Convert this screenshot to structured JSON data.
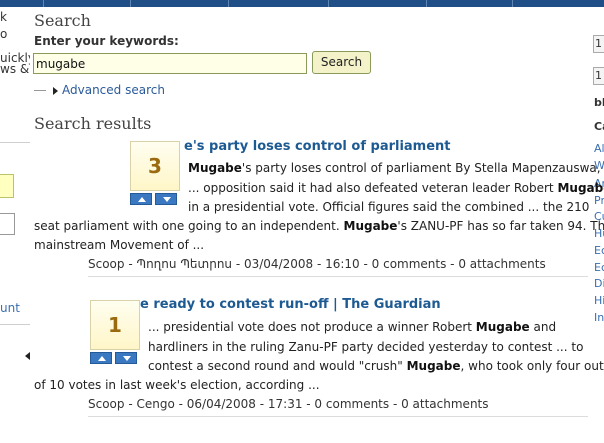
{
  "left_sidebar": {
    "fragments": [
      "k",
      "o",
      "uickly",
      "ws &",
      "unt"
    ]
  },
  "right_sidebar": {
    "inputs": [
      "1",
      "1"
    ],
    "heading": "bl",
    "heading2": "Ca",
    "links": [
      "Al",
      "W",
      "Ar",
      "Pr",
      "Cu",
      "Hu",
      "Ec",
      "Ec",
      "Di",
      "Hi",
      "In"
    ]
  },
  "search": {
    "heading": "Search",
    "keywords_label": "Enter your keywords:",
    "query": "mugabe",
    "button_label": "Search",
    "advanced_link": "Advanced search"
  },
  "results": {
    "heading": "Search results",
    "items": [
      {
        "votes": "3",
        "title": "e's party loses control of parliament",
        "lines": [
          [
            {
              "t": "Mugabe",
              "b": true
            },
            {
              "t": "'s party loses control of parliament By Stella Mapenzauswa,",
              "b": false
            }
          ],
          [
            {
              "t": "... opposition said it had also defeated veteran leader Robert ",
              "b": false
            },
            {
              "t": "Mugabe",
              "b": true
            }
          ],
          [
            {
              "t": "in a presidential vote. Official figures said the combined ... the 210",
              "b": false
            }
          ],
          [
            {
              "t": "seat parliament with one going to an independent. ",
              "b": false
            },
            {
              "t": "Mugabe",
              "b": true
            },
            {
              "t": "'s ZANU-PF has so far taken 94. The",
              "b": false
            }
          ],
          [
            {
              "t": "mainstream Movement of ...",
              "b": false
            }
          ]
        ],
        "meta": "Scoop - Պողոս Պետրոս - 03/04/2008 - 16:10 - 0 comments - 0 attachments"
      },
      {
        "votes": "1",
        "title": "e ready to contest run-off | The Guardian",
        "lines": [
          [
            {
              "t": "... presidential vote does not produce a winner Robert ",
              "b": false
            },
            {
              "t": "Mugabe",
              "b": true
            },
            {
              "t": " and",
              "b": false
            }
          ],
          [
            {
              "t": "hardliners in the ruling Zanu-PF party decided yesterday to contest ... to",
              "b": false
            }
          ],
          [
            {
              "t": "contest a second round and would \"crush\" ",
              "b": false
            },
            {
              "t": "Mugabe",
              "b": true
            },
            {
              "t": ", who took only four out",
              "b": false
            }
          ],
          [
            {
              "t": "of 10 votes in last week's election, according ...",
              "b": false
            }
          ]
        ],
        "meta": "Scoop - Cengo - 06/04/2008 - 17:31 - 0 comments - 0 attachments"
      }
    ]
  },
  "colors": {
    "top_strip": "#1f4f86",
    "link": "#1e5a92",
    "vote_number": "#9a6a10",
    "vote_button": "#3b78c2"
  }
}
